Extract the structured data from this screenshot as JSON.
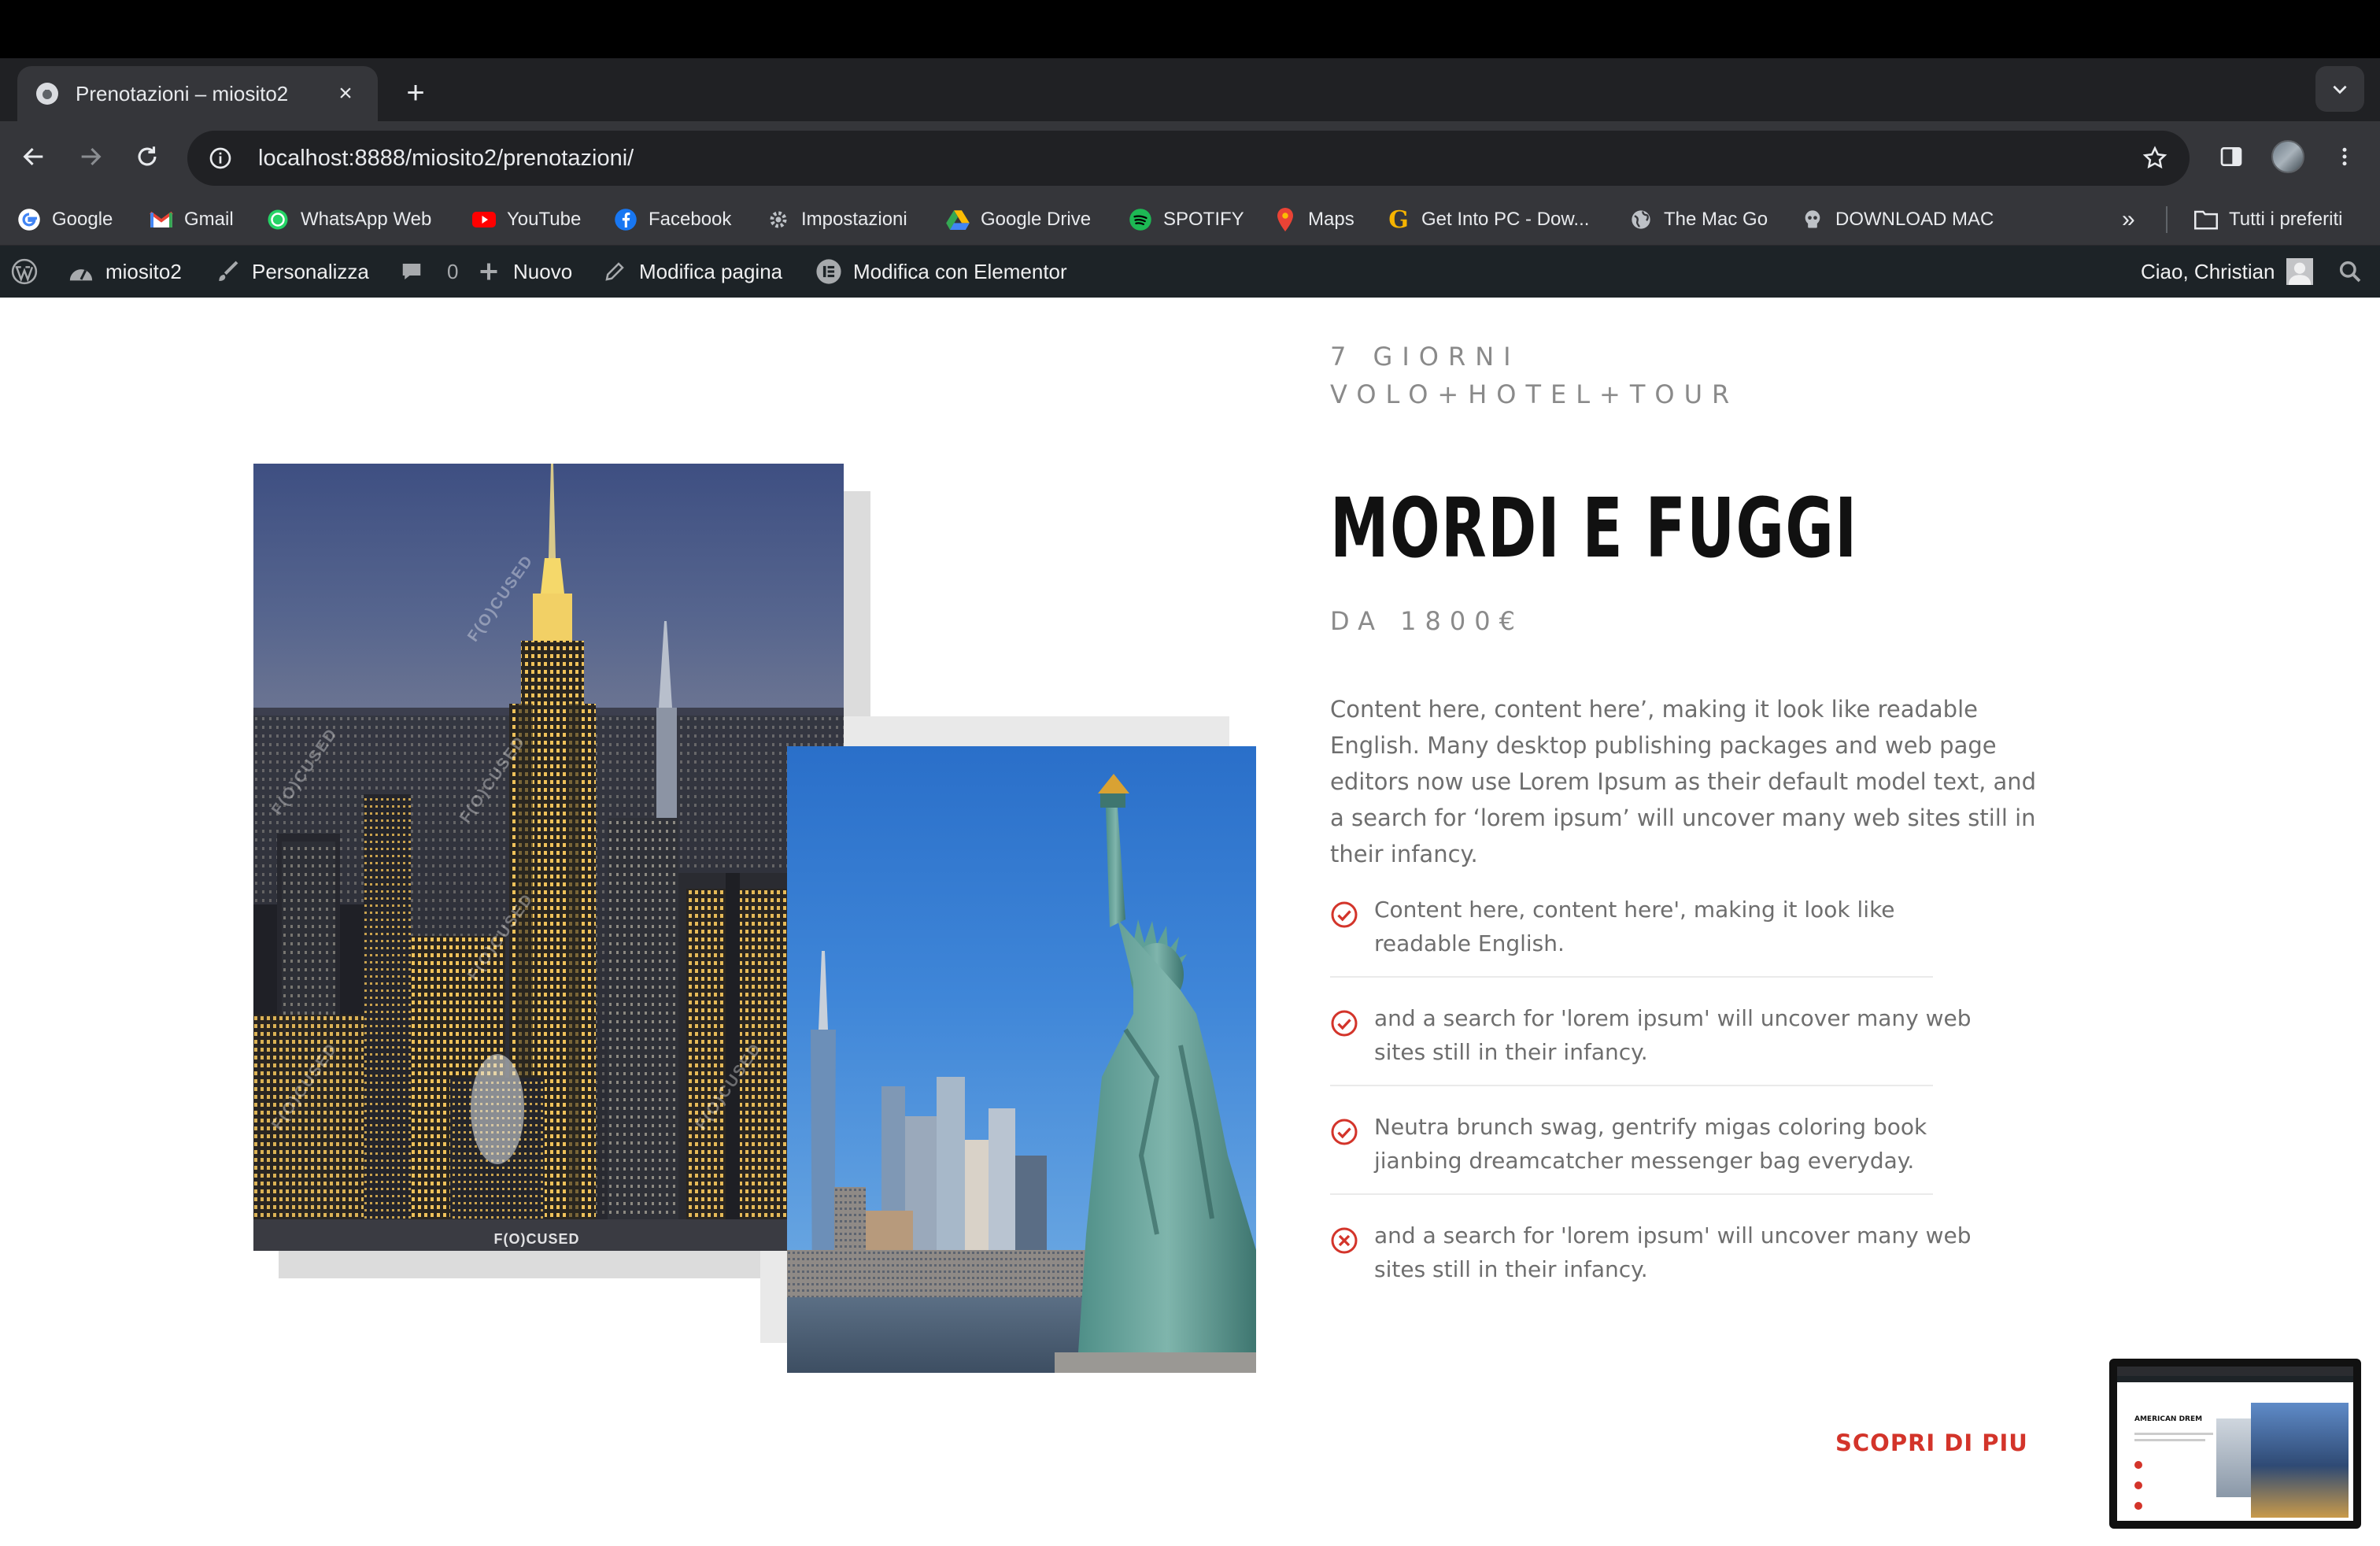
{
  "browser": {
    "tab_title": "Prenotazioni – miosito2",
    "url_host": "localhost",
    "url_rest": ":8888/miosito2/prenotazioni/"
  },
  "bookmarks": [
    {
      "label": "Google",
      "icon": "google-icon",
      "color": "#4285f4"
    },
    {
      "label": "Gmail",
      "icon": "gmail-icon",
      "color": "#ea4335"
    },
    {
      "label": "WhatsApp Web",
      "icon": "whatsapp-icon",
      "color": "#25d366"
    },
    {
      "label": "YouTube",
      "icon": "youtube-icon",
      "color": "#ff0000"
    },
    {
      "label": "Facebook",
      "icon": "facebook-icon",
      "color": "#1877f2"
    },
    {
      "label": "Impostazioni",
      "icon": "gear-icon",
      "color": "#bdc1c6"
    },
    {
      "label": "Google Drive",
      "icon": "google-drive-icon",
      "color": "#fbbc04"
    },
    {
      "label": "SPOTIFY",
      "icon": "spotify-icon",
      "color": "#1db954"
    },
    {
      "label": "Maps",
      "icon": "maps-icon",
      "color": "#34a853"
    },
    {
      "label": "Get Into PC - Dow...",
      "icon": "getintopc-icon",
      "color": "#f6b400"
    },
    {
      "label": "The Mac Go",
      "icon": "globe-icon",
      "color": "#bdc1c6"
    },
    {
      "label": "DOWNLOAD MAC",
      "icon": "skull-icon",
      "color": "#bdc1c6"
    }
  ],
  "bookmarks_all": "Tutti i preferiti",
  "wp_admin": {
    "site": "miosito2",
    "customize": "Personalizza",
    "comments": "0",
    "new": "Nuovo",
    "edit_page": "Modifica pagina",
    "edit_elementor": "Modifica con Elementor",
    "greeting": "Ciao, Christian"
  },
  "content": {
    "kicker_line1": "7 GIORNI",
    "kicker_line2": "VOLO+HOTEL+TOUR",
    "title": "MORDI E FUGGI",
    "price": "DA 1800€",
    "intro": "Content here, content here’, making it look like readable English. Many desktop publishing packages and web page editors now use Lorem Ipsum as their default model text, and a search for ‘lorem ipsum’ will uncover many web sites still in their infancy.",
    "features": [
      {
        "text": "Content here, content here', making it look like readable English.",
        "status": "check"
      },
      {
        "text": "and a search for 'lorem ipsum' will uncover many web sites still in their infancy.",
        "status": "check"
      },
      {
        "text": "Neutra brunch swag, gentrify migas coloring book jianbing dreamcatcher messenger bag everyday.",
        "status": "check"
      },
      {
        "text": "and a search for 'lorem ipsum' will uncover many web sites still in their infancy.",
        "status": "cross"
      }
    ],
    "cta": "SCOPRI DI PIU",
    "photo_watermark": "F(O)CUSED",
    "thumb_title": "AMERICAN DREM"
  },
  "colors": {
    "accent": "#d3342a",
    "wpbar": "#1d2327",
    "chrome_toolbar": "#35363a"
  }
}
